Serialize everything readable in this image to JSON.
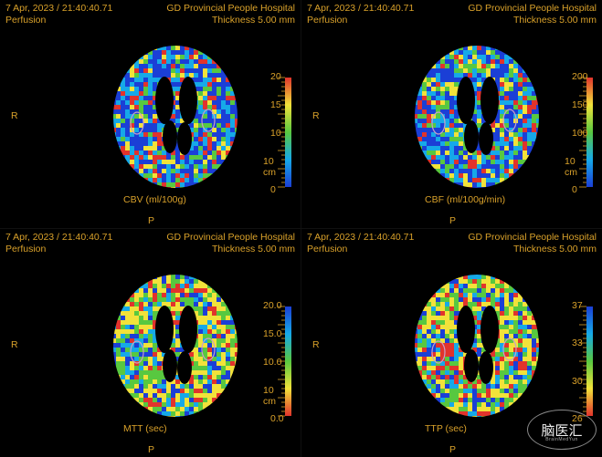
{
  "common": {
    "date": "7 Apr, 2023 / 21:40:40.71",
    "mode": "Perfusion",
    "hospital": "GD Provincial People Hospital",
    "thickness": "Thickness 5.00 mm",
    "orient_r": "R",
    "orient_p": "P"
  },
  "panels": [
    {
      "label": "CBV (ml/100g)",
      "scale_type": "cool",
      "ticks": [
        "20",
        "15",
        "10",
        "10 cm",
        "0"
      ]
    },
    {
      "label": "CBF (ml/100g/min)",
      "scale_type": "cool",
      "ticks": [
        "200",
        "150",
        "100",
        "10 cm",
        "0"
      ]
    },
    {
      "label": "MTT (sec)",
      "scale_type": "warm",
      "ticks": [
        "20.0",
        "15.0",
        "10.0",
        "10 cm",
        "0.0"
      ]
    },
    {
      "label": "TTP (sec)",
      "scale_type": "warm",
      "ticks": [
        "37",
        "33",
        "30",
        "26"
      ]
    }
  ],
  "logo": {
    "text": "脑医汇",
    "sub": "BrainMedYun"
  },
  "colors": {
    "text": "#d9a12a",
    "low": "#1b3fd6",
    "mid_low": "#16a9e8",
    "mid": "#58c840",
    "mid_high": "#f2e23a",
    "high": "#e1332c"
  }
}
